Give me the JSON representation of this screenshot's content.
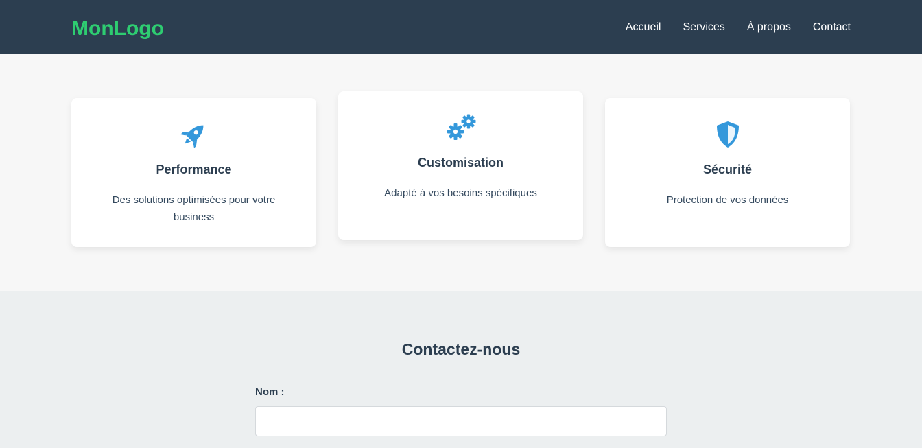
{
  "header": {
    "logo": "MonLogo",
    "nav": [
      "Accueil",
      "Services",
      "À propos",
      "Contact"
    ]
  },
  "features": [
    {
      "icon": "rocket-icon",
      "title": "Performance",
      "text": "Des solutions optimisées pour votre business"
    },
    {
      "icon": "gears-icon",
      "title": "Customisation",
      "text": "Adapté à vos besoins spécifiques"
    },
    {
      "icon": "shield-icon",
      "title": "Sécurité",
      "text": "Protection de vos données"
    }
  ],
  "contact": {
    "title": "Contactez-nous",
    "name_label": "Nom :",
    "name_value": "",
    "name_placeholder": ""
  },
  "colors": {
    "header_bg": "#2c3e50",
    "logo": "#2ecc71",
    "icon": "#3498db",
    "page_bg": "#f7f7f7",
    "contact_bg": "#eceff0"
  }
}
